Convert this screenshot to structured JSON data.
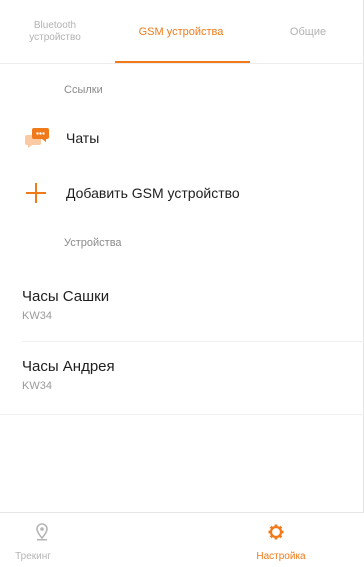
{
  "tabs": {
    "bluetooth_line1": "Bluetooth",
    "bluetooth_line2": "устройство",
    "gsm": "GSM устройства",
    "common": "Общие"
  },
  "links_section": {
    "header": "Ссылки",
    "chats_label": "Чаты",
    "add_label": "Добавить GSM устройство"
  },
  "devices_section": {
    "header": "Устройства",
    "devices": [
      {
        "name": "Часы Сашки",
        "model": "KW34"
      },
      {
        "name": "Часы Андрея",
        "model": "KW34"
      }
    ]
  },
  "bottom_nav": {
    "tracking": "Трекинг",
    "settings": "Настройка"
  },
  "colors": {
    "accent": "#f07a1a",
    "inactive": "#b2b2b2"
  },
  "icons": [
    "chat-icon",
    "plus-icon",
    "location-pin-icon",
    "gear-icon"
  ]
}
